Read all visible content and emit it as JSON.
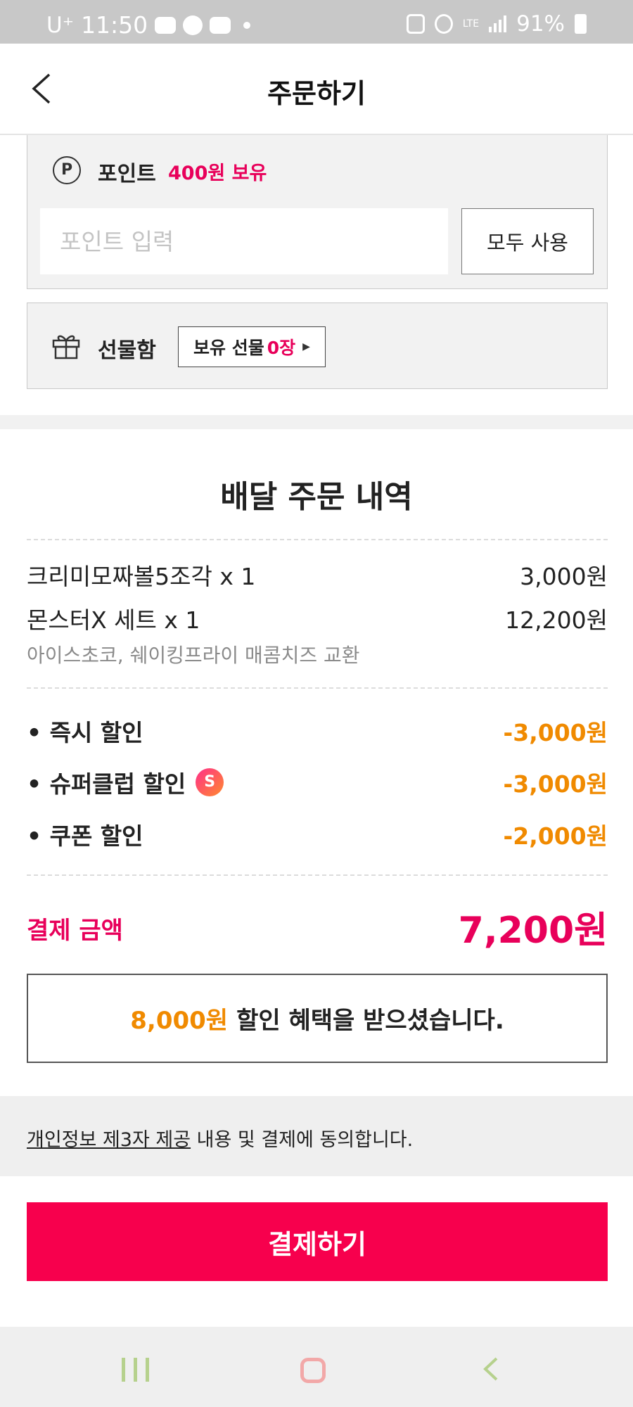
{
  "status_bar": {
    "carrier": "U⁺",
    "time": "11:50",
    "network": "LTE",
    "battery": "91%"
  },
  "header": {
    "title": "주문하기",
    "back_icon": "chevron-left-icon"
  },
  "points": {
    "icon": "P",
    "label": "포인트",
    "owned": "400원 보유",
    "input_placeholder": "포인트 입력",
    "use_all": "모두 사용"
  },
  "gift": {
    "icon": "gift-icon",
    "label": "선물함",
    "button_prefix": "보유 선물",
    "button_count": "0장"
  },
  "order": {
    "title": "배달 주문 내역",
    "items": [
      {
        "name": "크리미모짜볼5조각 x 1",
        "price": "3,000원"
      },
      {
        "name": "몬스터X 세트 x 1",
        "price": "12,200원"
      }
    ],
    "item_option": "아이스초코, 쉐이킹프라이 매콤치즈 교환",
    "discounts": [
      {
        "name": "• 즉시 할인",
        "amount": "-3,000원"
      },
      {
        "name": "• 슈퍼클럽 할인",
        "amount": "-3,000원"
      },
      {
        "name": "• 쿠폰 할인",
        "amount": "-2,000원"
      }
    ],
    "supercub_icon": "S",
    "pay_label": "결제 금액",
    "pay_amount": "7,200원",
    "benefit_amount": "8,000원",
    "benefit_text": "할인 혜택을 받으셨습니다."
  },
  "consent": {
    "link": "개인정보 제3자 제공",
    "text": " 내용 및 결제에 동의합니다."
  },
  "pay_button": "결제하기",
  "colors": {
    "accent": "#f7004d",
    "point_pink": "#e8005a",
    "discount_orange": "#f08a00"
  }
}
